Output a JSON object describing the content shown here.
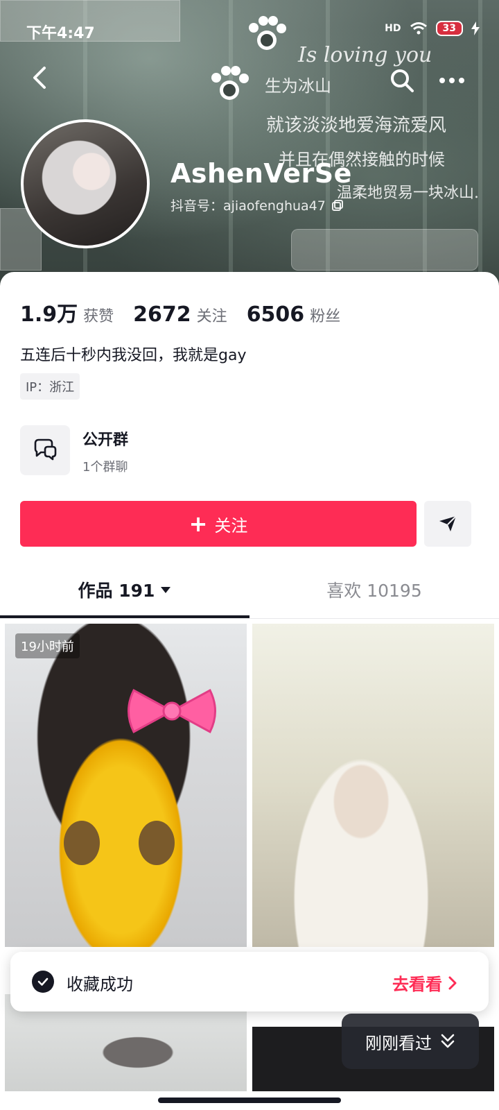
{
  "status_bar": {
    "time": "下午4:47",
    "signal": "HD",
    "battery": "33"
  },
  "header": {
    "decorative_texts": [
      "Is loving you",
      "生为冰山",
      "就该淡淡地爱海流爱风",
      "并且在偶然接触的时候",
      "温柔地贸易一块冰山."
    ],
    "nickname": "AshenVerSe",
    "douyin_id": "抖音号：ajiaofenghua47"
  },
  "stats": {
    "likes_num": "1.9万",
    "likes_label": "获赞",
    "following_num": "2672",
    "following_label": "关注",
    "followers_num": "6506",
    "followers_label": "粉丝"
  },
  "bio": "五连后十秒内我没回，我就是gay",
  "ip": "IP：浙江",
  "group": {
    "title": "公开群",
    "subtitle": "1个群聊"
  },
  "actions": {
    "follow_label": "关注",
    "plus": "+"
  },
  "tabs": {
    "works": "作品 191",
    "likes": "喜欢 10195"
  },
  "grid": {
    "first_time": "19小时前"
  },
  "toast": {
    "text": "收藏成功",
    "action": "去看看"
  },
  "recent": "刚刚看过",
  "colors": {
    "accent": "#fe2c55",
    "text_primary": "#161823",
    "text_secondary": "#6b6d75"
  },
  "icons": {
    "back": "chevron-left-icon",
    "search": "search-icon",
    "more": "more-icon",
    "copy": "copy-icon",
    "group": "chat-bubbles-icon",
    "share": "send-icon",
    "dropdown": "caret-down-icon",
    "check": "check-icon",
    "chevron_right": "chevron-right-icon",
    "double_chevron": "double-chevron-down-icon"
  }
}
